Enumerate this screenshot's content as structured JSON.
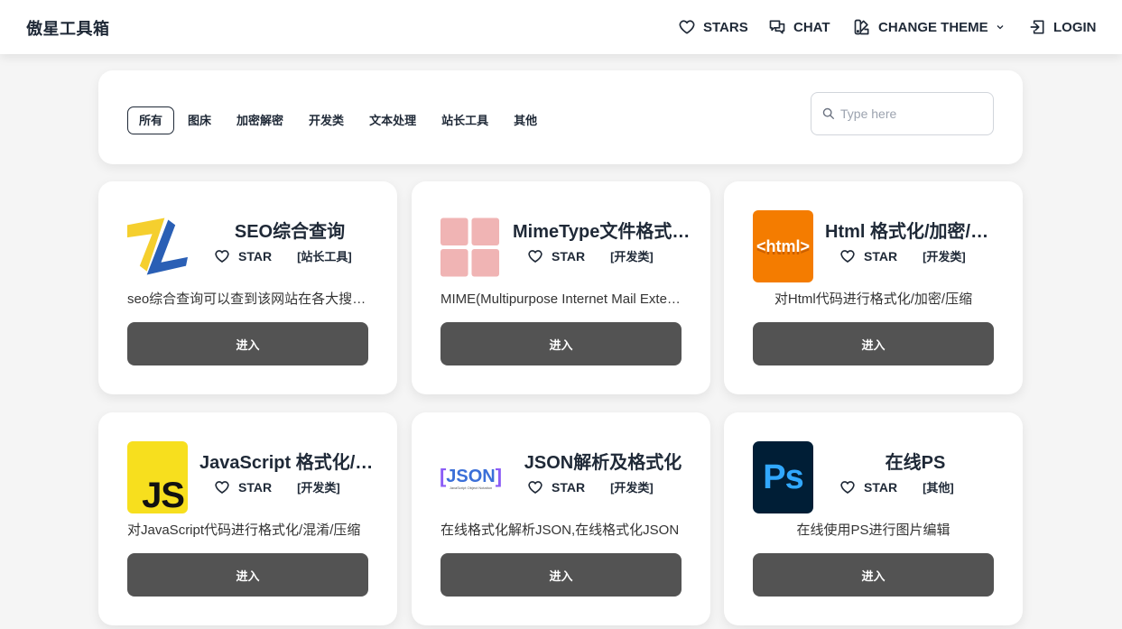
{
  "header": {
    "brand": "傲星工具箱",
    "nav": {
      "stars": "STARS",
      "chat": "CHAT",
      "theme": "CHANGE THEME",
      "login": "LOGIN"
    }
  },
  "filters": {
    "tabs": [
      {
        "label": "所有",
        "active": true
      },
      {
        "label": "图床",
        "active": false
      },
      {
        "label": "加密解密",
        "active": false
      },
      {
        "label": "开发类",
        "active": false
      },
      {
        "label": "文本处理",
        "active": false
      },
      {
        "label": "站长工具",
        "active": false
      },
      {
        "label": "其他",
        "active": false
      }
    ],
    "search": {
      "placeholder": "Type here",
      "value": ""
    }
  },
  "tools": [
    {
      "title": "SEO综合查询",
      "star_label": "STAR",
      "category": "[站长工具]",
      "description": "seo综合查询可以查到该网站在各大搜索引擎的信息",
      "button": "进入",
      "logo": "zl-logo"
    },
    {
      "title": "MimeType文件格式大全",
      "star_label": "STAR",
      "category": "[开发类]",
      "description": "MIME(Multipurpose Internet Mail Extensions)多用途互联网邮件扩展类型",
      "button": "进入",
      "logo": "grid-logo"
    },
    {
      "title": "Html 格式化/加密/压缩",
      "star_label": "STAR",
      "category": "[开发类]",
      "description": "对Html代码进行格式化/加密/压缩",
      "button": "进入",
      "logo": "html-logo"
    },
    {
      "title": "JavaScript 格式化/混淆/压缩",
      "star_label": "STAR",
      "category": "[开发类]",
      "description": "对JavaScript代码进行格式化/混淆/压缩",
      "button": "进入",
      "logo": "js-logo"
    },
    {
      "title": "JSON解析及格式化",
      "star_label": "STAR",
      "category": "[开发类]",
      "description": "在线格式化解析JSON,在线格式化JSON",
      "button": "进入",
      "logo": "json-logo"
    },
    {
      "title": "在线PS",
      "star_label": "STAR",
      "category": "[其他]",
      "description": "在线使用PS进行图片编辑",
      "button": "进入",
      "logo": "ps-logo"
    }
  ],
  "logo_text": {
    "html": "<html>",
    "js": "JS",
    "json": "JSON",
    "json_sub": "JavaScript Object Notation",
    "ps": "Ps"
  },
  "colors": {
    "button_bg": "#535353",
    "html_orange": "#f47c00",
    "js_yellow": "#f7df1e",
    "ps_navy": "#001e36",
    "ps_blue": "#31a8ff",
    "mime_pink": "#f0b4b4"
  }
}
